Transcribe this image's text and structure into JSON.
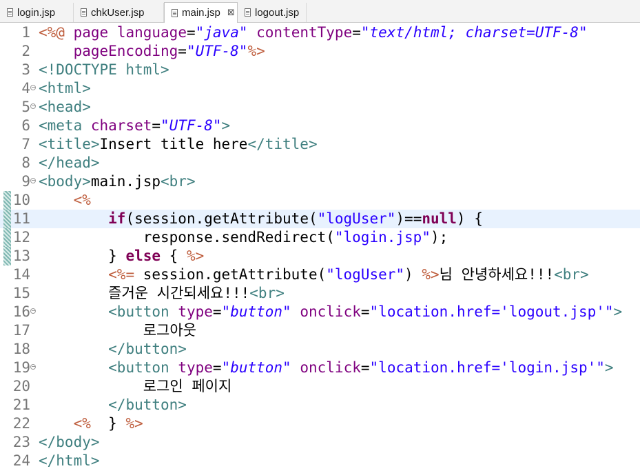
{
  "tabs": [
    {
      "label": "login.jsp",
      "active": false
    },
    {
      "label": "chkUser.jsp",
      "active": false
    },
    {
      "label": "main.jsp",
      "active": true
    },
    {
      "label": "logout.jsp",
      "active": false
    }
  ],
  "close_glyph": "⊠",
  "current_line": 11,
  "changed_lines": [
    10,
    11,
    12,
    13
  ],
  "fold_lines": [
    4,
    5,
    9,
    16,
    19
  ],
  "colors": {
    "jsp_delimiter": "#bf5f3f",
    "tag": "#3f7f7f",
    "attribute": "#7f007f",
    "string": "#2a00ff",
    "keyword": "#7f0055",
    "current_line_bg": "#e8f2fe"
  },
  "lines": [
    {
      "n": "1",
      "tokens": [
        [
          "d",
          "<%@ "
        ],
        [
          "a",
          "page"
        ],
        [
          "x",
          " "
        ],
        [
          "a",
          "language"
        ],
        [
          "x",
          "="
        ],
        [
          "si",
          "\"java\""
        ],
        [
          "x",
          " "
        ],
        [
          "a",
          "contentType"
        ],
        [
          "x",
          "="
        ],
        [
          "si",
          "\"text/html; charset=UTF-8\""
        ]
      ]
    },
    {
      "n": "2",
      "tokens": [
        [
          "x",
          "    "
        ],
        [
          "a",
          "pageEncoding"
        ],
        [
          "x",
          "="
        ],
        [
          "si",
          "\"UTF-8\""
        ],
        [
          "d",
          "%>"
        ]
      ]
    },
    {
      "n": "3",
      "tokens": [
        [
          "t",
          "<!DOCTYPE html>"
        ]
      ]
    },
    {
      "n": "4",
      "tokens": [
        [
          "t",
          "<html>"
        ]
      ]
    },
    {
      "n": "5",
      "tokens": [
        [
          "t",
          "<head>"
        ]
      ]
    },
    {
      "n": "6",
      "tokens": [
        [
          "t",
          "<meta "
        ],
        [
          "a",
          "charset"
        ],
        [
          "x",
          "="
        ],
        [
          "si",
          "\"UTF-8\""
        ],
        [
          "t",
          ">"
        ]
      ]
    },
    {
      "n": "7",
      "tokens": [
        [
          "t",
          "<title>"
        ],
        [
          "x",
          "Insert title here"
        ],
        [
          "t",
          "</title>"
        ]
      ]
    },
    {
      "n": "8",
      "tokens": [
        [
          "t",
          "</head>"
        ]
      ]
    },
    {
      "n": "9",
      "tokens": [
        [
          "t",
          "<body>"
        ],
        [
          "x",
          "main.jsp"
        ],
        [
          "t",
          "<br>"
        ]
      ]
    },
    {
      "n": "10",
      "tokens": [
        [
          "x",
          "    "
        ],
        [
          "d",
          "<%"
        ]
      ]
    },
    {
      "n": "11",
      "tokens": [
        [
          "x",
          "        "
        ],
        [
          "k",
          "if"
        ],
        [
          "x",
          "(session.getAttribute("
        ],
        [
          "s",
          "\"logUser\""
        ],
        [
          "x",
          ")=="
        ],
        [
          "k",
          "null"
        ],
        [
          "x",
          ") {"
        ]
      ]
    },
    {
      "n": "12",
      "tokens": [
        [
          "x",
          "            response.sendRedirect("
        ],
        [
          "s",
          "\"login.jsp\""
        ],
        [
          "x",
          ");"
        ]
      ]
    },
    {
      "n": "13",
      "tokens": [
        [
          "x",
          "        } "
        ],
        [
          "k",
          "else"
        ],
        [
          "x",
          " { "
        ],
        [
          "d",
          "%>"
        ]
      ]
    },
    {
      "n": "14",
      "tokens": [
        [
          "x",
          "        "
        ],
        [
          "d",
          "<%="
        ],
        [
          "x",
          " session.getAttribute("
        ],
        [
          "s",
          "\"logUser\""
        ],
        [
          "x",
          ") "
        ],
        [
          "d",
          "%>"
        ],
        [
          "x",
          "님 안녕하세요!!!"
        ],
        [
          "t",
          "<br>"
        ]
      ]
    },
    {
      "n": "15",
      "tokens": [
        [
          "x",
          "        즐거운 시간되세요!!!"
        ],
        [
          "t",
          "<br>"
        ]
      ]
    },
    {
      "n": "16",
      "tokens": [
        [
          "x",
          "        "
        ],
        [
          "t",
          "<button "
        ],
        [
          "a",
          "type"
        ],
        [
          "x",
          "="
        ],
        [
          "si",
          "\"button\""
        ],
        [
          "x",
          " "
        ],
        [
          "a",
          "onclick"
        ],
        [
          "x",
          "="
        ],
        [
          "s",
          "\"location.href='logout.jsp'\""
        ],
        [
          "t",
          ">"
        ]
      ]
    },
    {
      "n": "17",
      "tokens": [
        [
          "x",
          "            로그아웃"
        ]
      ]
    },
    {
      "n": "18",
      "tokens": [
        [
          "x",
          "        "
        ],
        [
          "t",
          "</button>"
        ]
      ]
    },
    {
      "n": "19",
      "tokens": [
        [
          "x",
          "        "
        ],
        [
          "t",
          "<button "
        ],
        [
          "a",
          "type"
        ],
        [
          "x",
          "="
        ],
        [
          "si",
          "\"button\""
        ],
        [
          "x",
          " "
        ],
        [
          "a",
          "onclick"
        ],
        [
          "x",
          "="
        ],
        [
          "s",
          "\"location.href='login.jsp'\""
        ],
        [
          "t",
          ">"
        ]
      ]
    },
    {
      "n": "20",
      "tokens": [
        [
          "x",
          "            로그인 페이지"
        ]
      ]
    },
    {
      "n": "21",
      "tokens": [
        [
          "x",
          "        "
        ],
        [
          "t",
          "</button>"
        ]
      ]
    },
    {
      "n": "22",
      "tokens": [
        [
          "x",
          "    "
        ],
        [
          "d",
          "<%"
        ],
        [
          "x",
          "  } "
        ],
        [
          "d",
          "%>"
        ]
      ]
    },
    {
      "n": "23",
      "tokens": [
        [
          "t",
          "</body>"
        ]
      ]
    },
    {
      "n": "24",
      "tokens": [
        [
          "t",
          "</html>"
        ]
      ]
    }
  ]
}
